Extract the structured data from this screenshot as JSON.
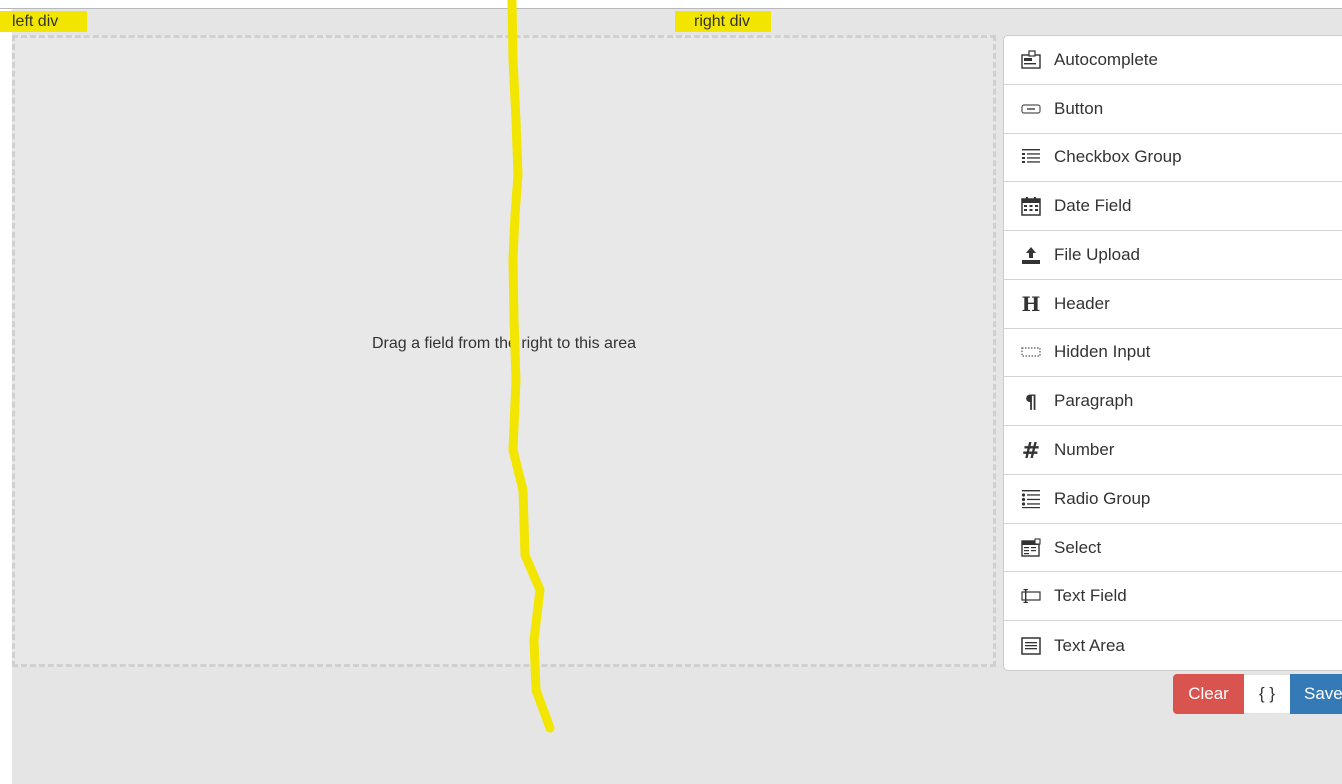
{
  "labels": {
    "left": "left div",
    "right": "right div"
  },
  "stage": {
    "message": "Drag a field from the right to this area"
  },
  "controls": [
    {
      "label": "Autocomplete",
      "icon": "autocomplete-icon"
    },
    {
      "label": "Button",
      "icon": "button-icon"
    },
    {
      "label": "Checkbox Group",
      "icon": "checkbox-group-icon"
    },
    {
      "label": "Date Field",
      "icon": "calendar-icon"
    },
    {
      "label": "File Upload",
      "icon": "upload-icon"
    },
    {
      "label": "Header",
      "icon": "header-icon"
    },
    {
      "label": "Hidden Input",
      "icon": "hidden-input-icon"
    },
    {
      "label": "Paragraph",
      "icon": "paragraph-icon"
    },
    {
      "label": "Number",
      "icon": "number-icon"
    },
    {
      "label": "Radio Group",
      "icon": "radio-group-icon"
    },
    {
      "label": "Select",
      "icon": "select-icon"
    },
    {
      "label": "Text Field",
      "icon": "text-field-icon"
    },
    {
      "label": "Text Area",
      "icon": "text-area-icon"
    }
  ],
  "actions": {
    "clear": "Clear",
    "data": "{ }",
    "save": "Save"
  },
  "colors": {
    "highlight": "#f2e600",
    "clear_button": "#d9534f",
    "save_button": "#337ab7",
    "stage_background": "#e8e8e8"
  }
}
